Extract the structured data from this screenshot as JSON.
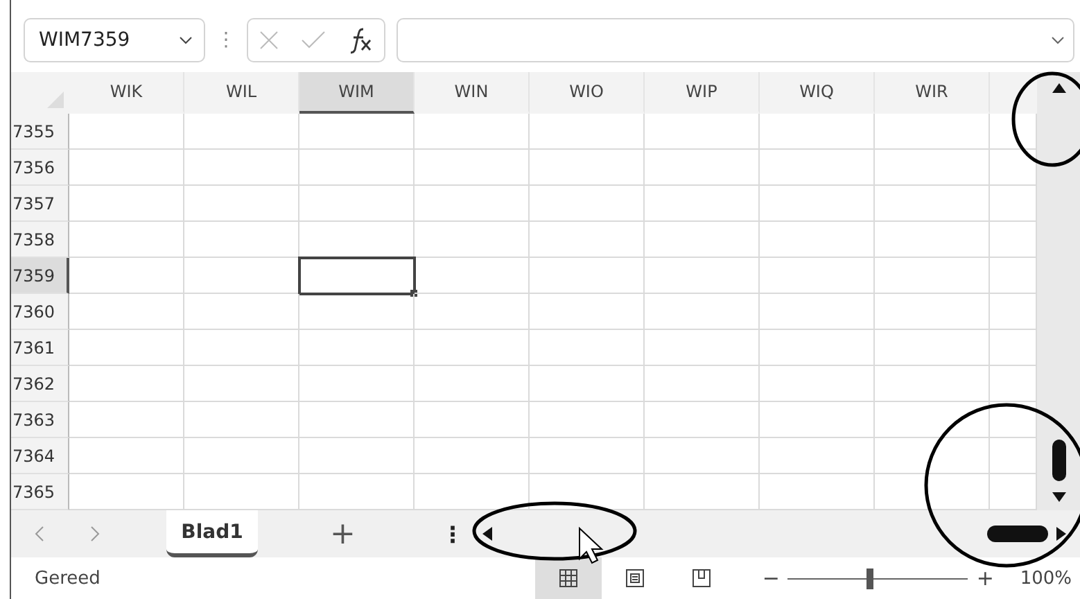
{
  "name_box": {
    "value": "WIM7359"
  },
  "formula_bar": {
    "separator": "⋮"
  },
  "columns": [
    {
      "label": "WIK",
      "selected": false
    },
    {
      "label": "WIL",
      "selected": false
    },
    {
      "label": "WIM",
      "selected": true
    },
    {
      "label": "WIN",
      "selected": false
    },
    {
      "label": "WIO",
      "selected": false
    },
    {
      "label": "WIP",
      "selected": false
    },
    {
      "label": "WIQ",
      "selected": false
    },
    {
      "label": "WIR",
      "selected": false
    }
  ],
  "rows": [
    {
      "label": "7355",
      "selected": false
    },
    {
      "label": "7356",
      "selected": false
    },
    {
      "label": "7357",
      "selected": false
    },
    {
      "label": "7358",
      "selected": false
    },
    {
      "label": "7359",
      "selected": true
    },
    {
      "label": "7360",
      "selected": false
    },
    {
      "label": "7361",
      "selected": false
    },
    {
      "label": "7362",
      "selected": false
    },
    {
      "label": "7363",
      "selected": false
    },
    {
      "label": "7364",
      "selected": false
    },
    {
      "label": "7365",
      "selected": false
    }
  ],
  "sheet_tabs": [
    {
      "label": "Blad1",
      "selected": true
    }
  ],
  "add_sheet": "+",
  "tab_more": "⋮",
  "status": "Gereed",
  "views": [
    {
      "kind": "normal",
      "selected": true
    },
    {
      "kind": "page-layout",
      "selected": false
    },
    {
      "kind": "page-break",
      "selected": false
    }
  ],
  "zoom": {
    "minus": "−",
    "plus": "+",
    "level": 0.45,
    "reading": "100%"
  }
}
